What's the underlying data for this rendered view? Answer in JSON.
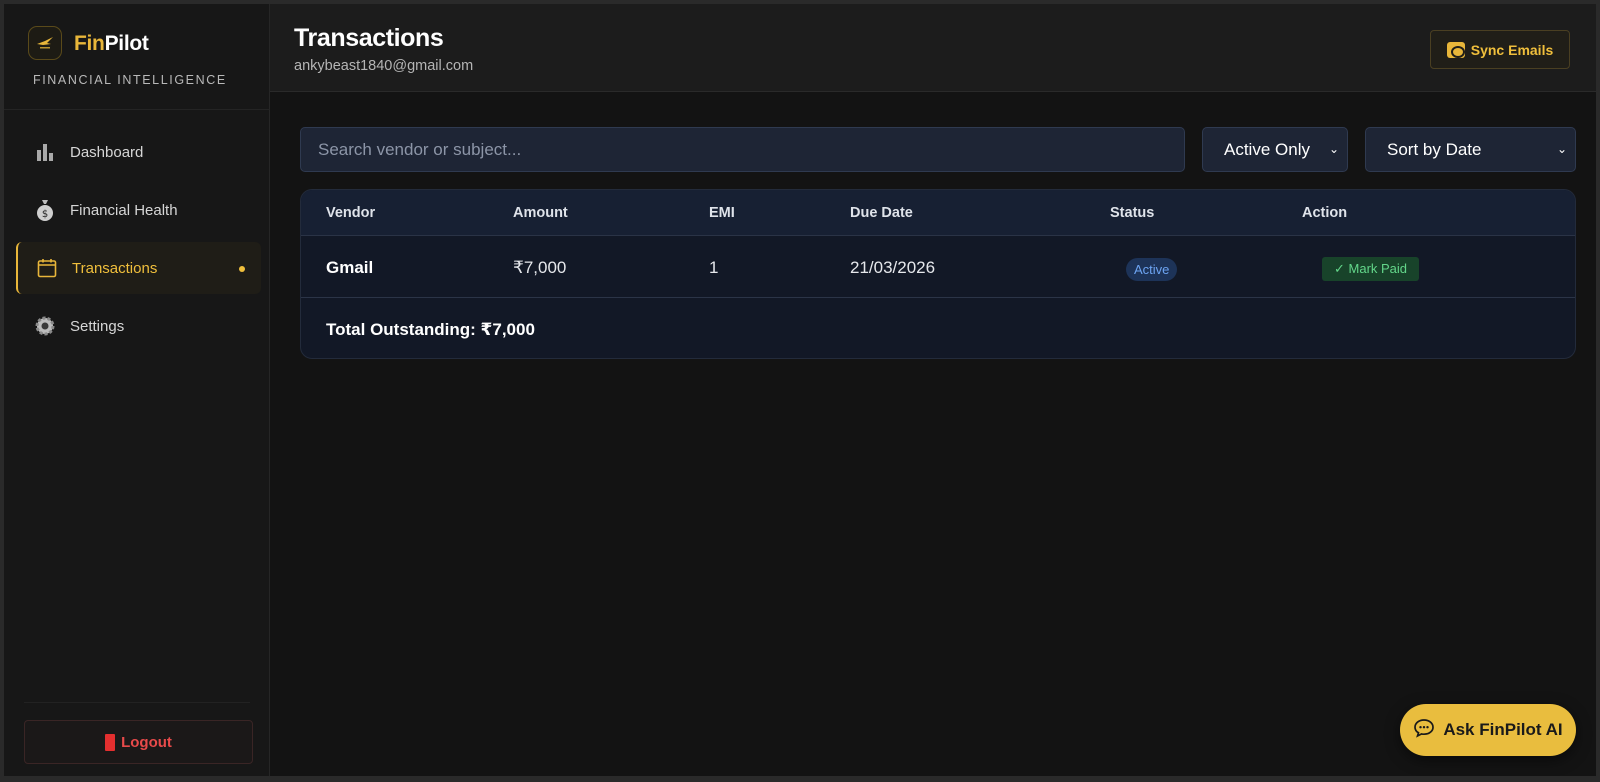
{
  "brand": {
    "name_part1": "Fin",
    "name_part2": "Pilot",
    "subtitle": "FINANCIAL INTELLIGENCE",
    "logo_icon": "finpilot-logo"
  },
  "sidebar": {
    "items": [
      {
        "label": "Dashboard",
        "icon": "bar-chart-icon",
        "active": false
      },
      {
        "label": "Financial Health",
        "icon": "money-bag-icon",
        "active": false
      },
      {
        "label": "Transactions",
        "icon": "calendar-icon",
        "active": true
      },
      {
        "label": "Settings",
        "icon": "gear-icon",
        "active": false
      }
    ],
    "logout_label": "Logout"
  },
  "header": {
    "title": "Transactions",
    "email": "ankybeast1840@gmail.com",
    "sync_label": "Sync Emails"
  },
  "filters": {
    "search_placeholder": "Search vendor or subject...",
    "status_filter": "Active Only",
    "sort": "Sort by Date"
  },
  "table": {
    "columns": [
      "Vendor",
      "Amount",
      "EMI",
      "Due Date",
      "Status",
      "Action"
    ],
    "rows": [
      {
        "vendor": "Gmail",
        "amount": "₹7,000",
        "emi": "1",
        "due_date": "21/03/2026",
        "status": "Active",
        "action": "✓ Mark Paid"
      }
    ],
    "total": "Total Outstanding: ₹7,000"
  },
  "assistant": {
    "label": "Ask FinPilot AI"
  },
  "colors": {
    "accent": "#e8b63a",
    "background": "#131313",
    "danger": "#e42f2f",
    "status_active": "#6da4f2",
    "success": "#63d68a"
  }
}
